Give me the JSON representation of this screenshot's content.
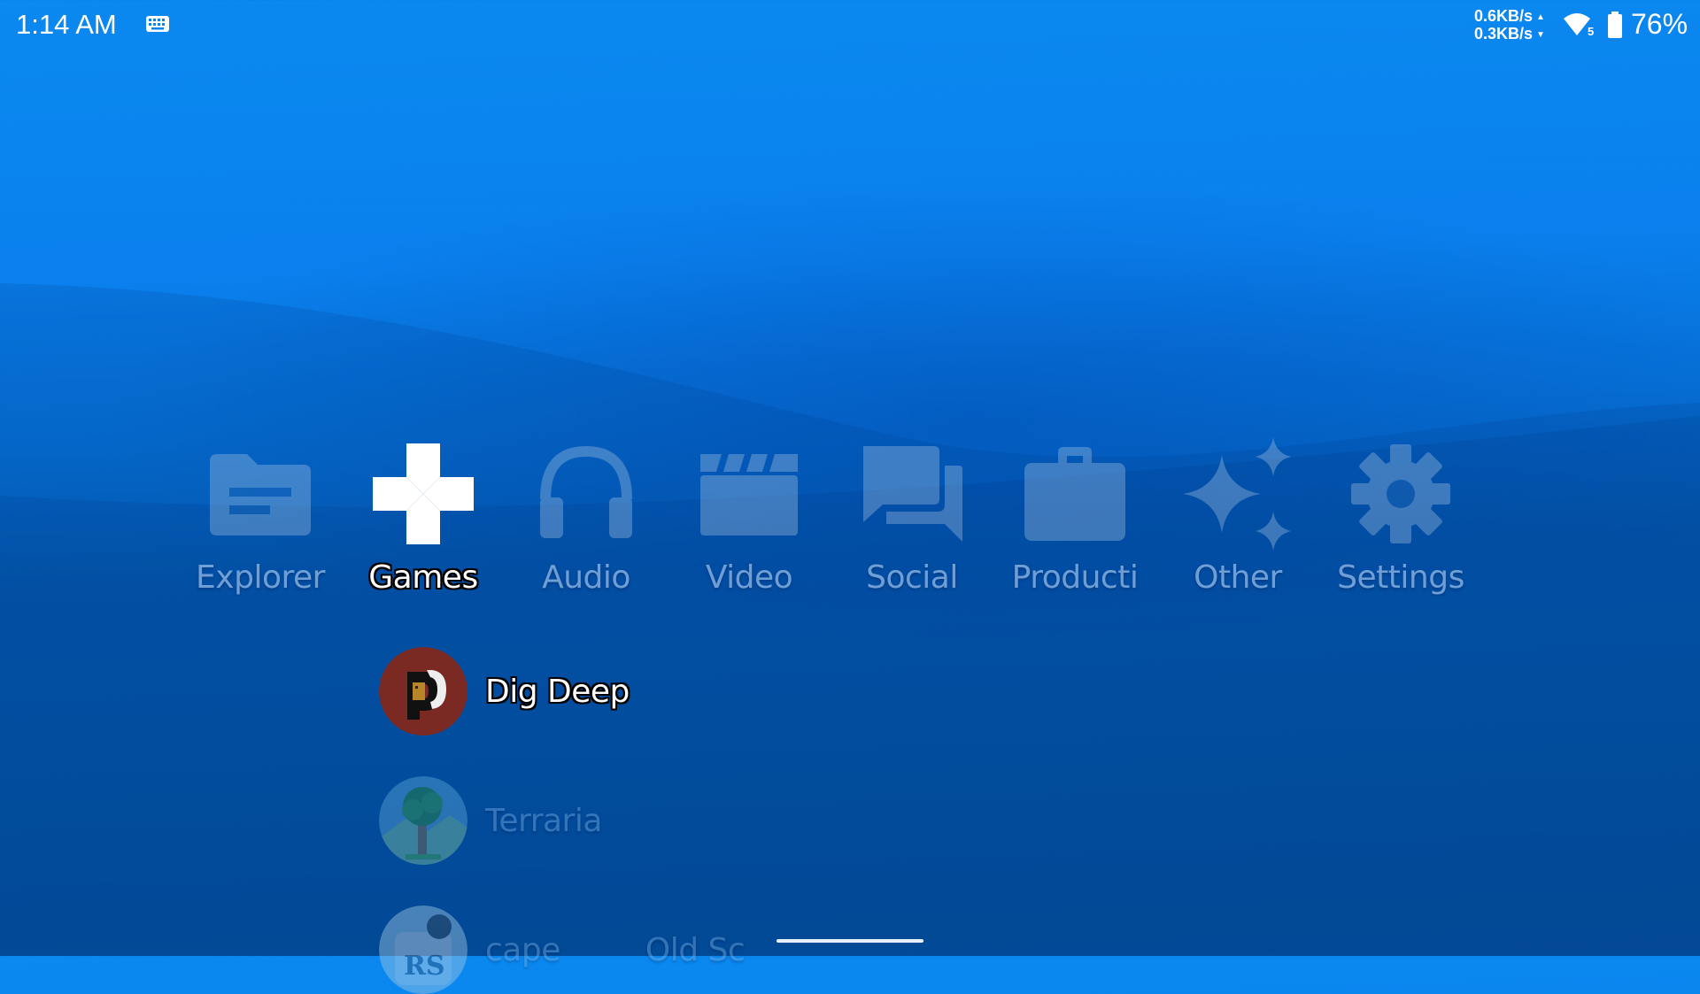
{
  "status_bar": {
    "time": "1:14 AM",
    "keyboard_icon": "keyboard-icon",
    "net_up": "0.6KB/s",
    "net_down": "0.3KB/s",
    "wifi_icon": "wifi-icon",
    "wifi_band": "5",
    "battery_icon": "battery-icon",
    "battery_percent": "76%"
  },
  "categories": [
    {
      "label": "Explorer",
      "icon": "folder-icon"
    },
    {
      "label": "Games",
      "icon": "gamepad-icon",
      "selected": true
    },
    {
      "label": "Audio",
      "icon": "headphones-icon"
    },
    {
      "label": "Video",
      "icon": "clapperboard-icon"
    },
    {
      "label": "Social",
      "icon": "chat-icon"
    },
    {
      "label": "Producti",
      "icon": "briefcase-icon"
    },
    {
      "label": "Other",
      "icon": "sparkles-icon"
    },
    {
      "label": "Settings",
      "icon": "gear-icon"
    }
  ],
  "games": [
    {
      "name": "Dig Deep",
      "icon": "dig-deep-app-icon",
      "selected": true
    },
    {
      "name": "Terraria",
      "icon": "terraria-app-icon"
    },
    {
      "name": "cape",
      "name_overlay": "Old Sc",
      "icon": "runescape-app-icon"
    }
  ],
  "colors": {
    "background_top": "#0b89f0",
    "background_bottom": "#04519f",
    "selected_text": "#ffffff",
    "dig_deep_bg": "#7a2a22"
  }
}
